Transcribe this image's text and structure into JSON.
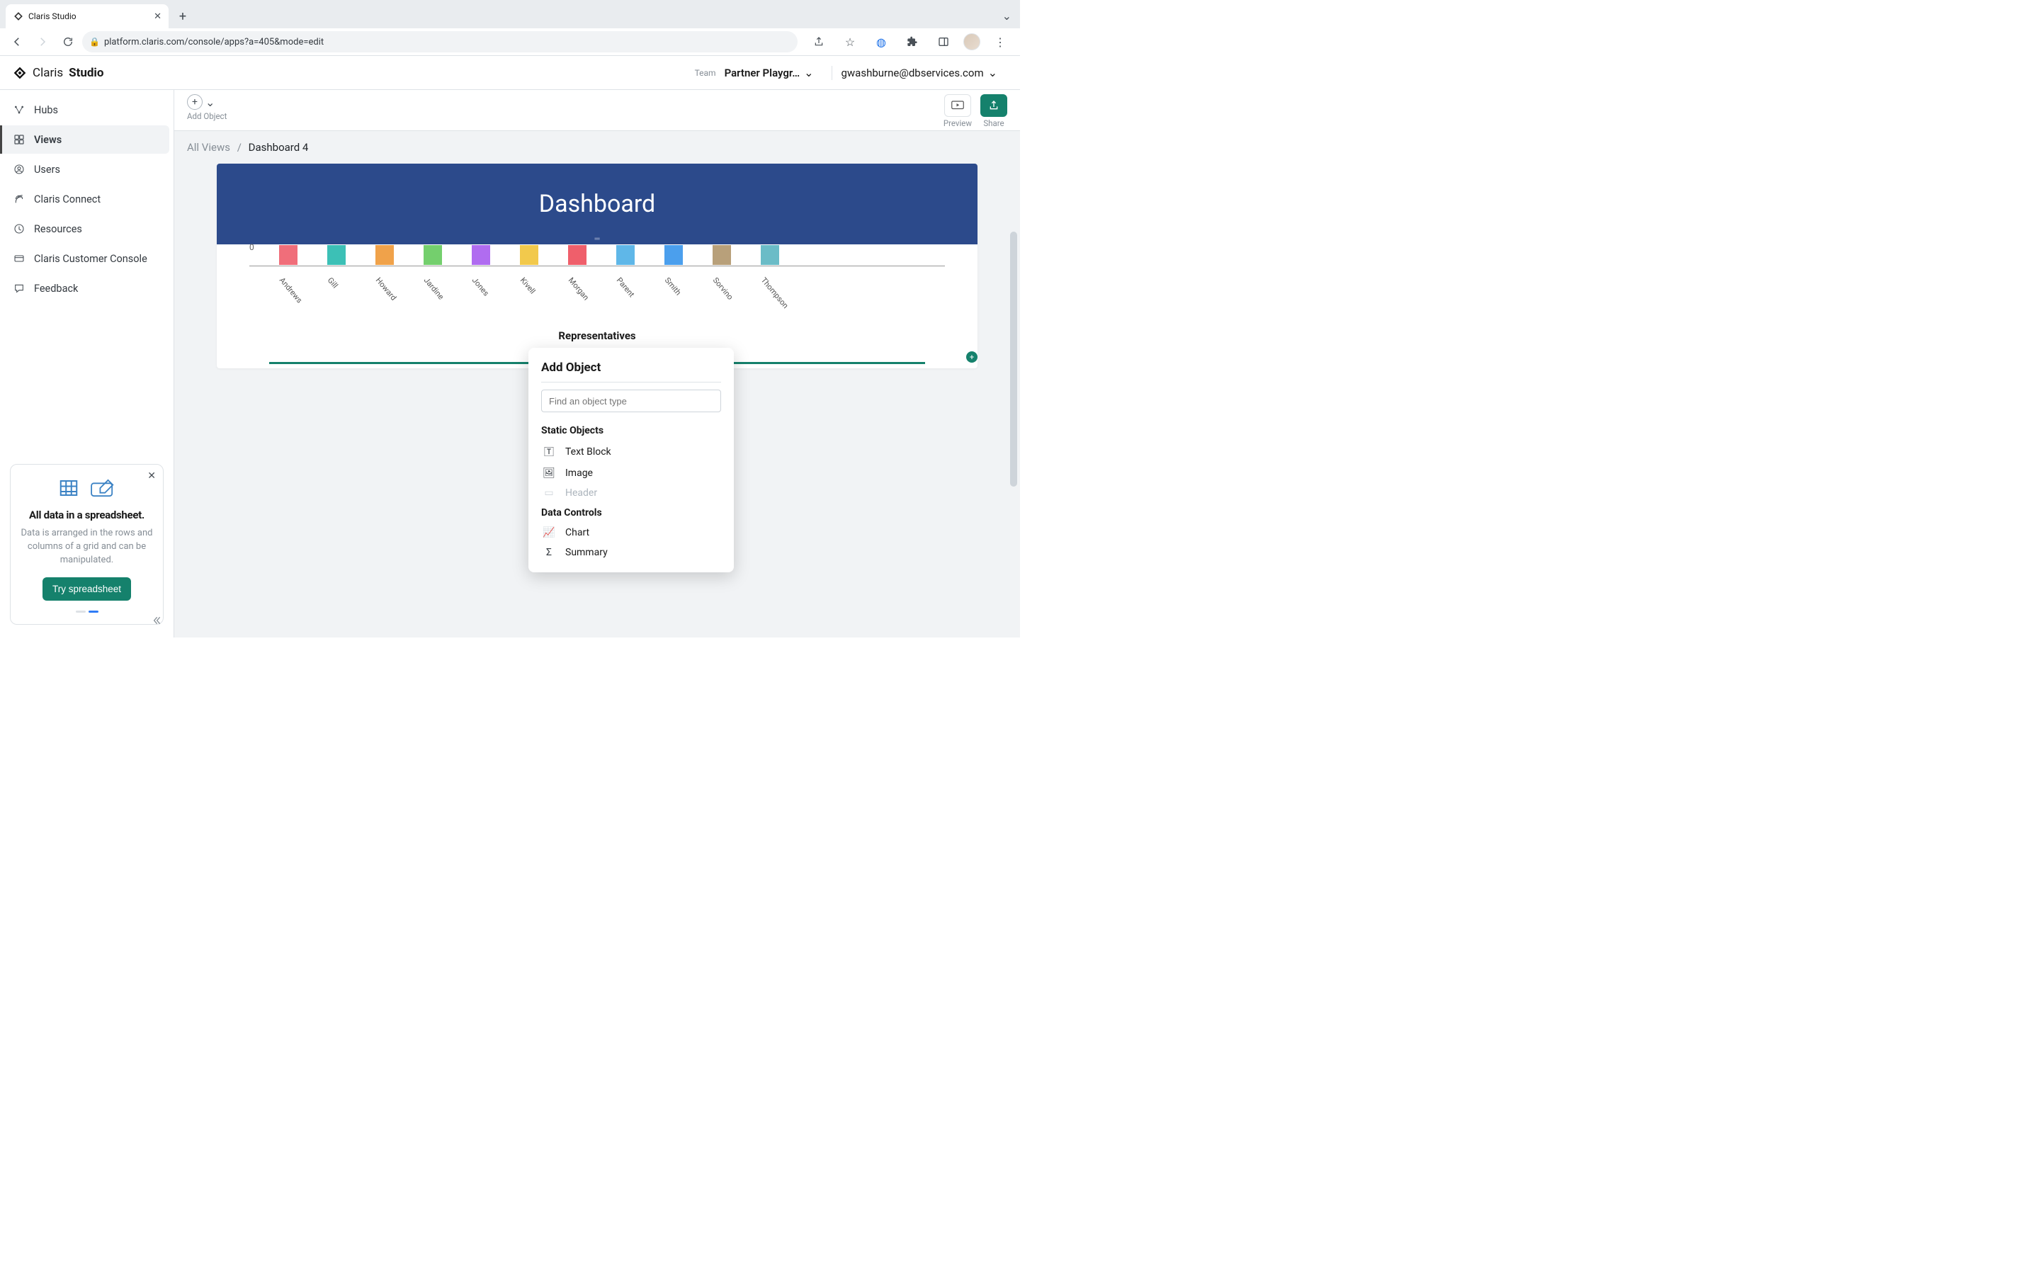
{
  "browser": {
    "tab_title": "Claris Studio",
    "url": "platform.claris.com/console/apps?a=405&mode=edit"
  },
  "header": {
    "brand_word1": "Claris",
    "brand_word2": "Studio",
    "team_label": "Team",
    "team_name": "Partner Playgr…",
    "user": "gwashburne@dbservices.com"
  },
  "sidebar": {
    "items": [
      {
        "label": "Hubs",
        "icon": "hubs"
      },
      {
        "label": "Views",
        "icon": "views",
        "active": true
      },
      {
        "label": "Users",
        "icon": "users"
      },
      {
        "label": "Claris Connect",
        "icon": "connect"
      },
      {
        "label": "Resources",
        "icon": "resources"
      },
      {
        "label": "Claris Customer Console",
        "icon": "console"
      },
      {
        "label": "Feedback",
        "icon": "feedback"
      }
    ],
    "promo": {
      "title": "All data in a spreadsheet.",
      "body": "Data is arranged in the rows and columns of a grid and can be manipulated.",
      "cta": "Try spreadsheet"
    }
  },
  "content_toolbar": {
    "add_object_label": "Add Object",
    "preview_label": "Preview",
    "share_label": "Share"
  },
  "breadcrumbs": {
    "root": "All Views",
    "sep": "/",
    "current": "Dashboard 4"
  },
  "hero": {
    "title": "Dashboard"
  },
  "chart_data": {
    "type": "bar",
    "title": "Representatives",
    "ylabel_tick": "0",
    "categories": [
      "Andrews",
      "Gill",
      "Howard",
      "Jardine",
      "Jones",
      "Kivell",
      "Morgan",
      "Parent",
      "Smith",
      "Sorvino",
      "Thompson"
    ],
    "values": [
      1,
      1,
      1,
      1,
      1,
      1,
      1,
      1,
      1,
      1,
      1
    ],
    "colors": [
      "#f06e7a",
      "#3cc0b6",
      "#f0a24a",
      "#74cf6d",
      "#b06cf0",
      "#f2c94c",
      "#ef5f6b",
      "#5fb7e8",
      "#4b9fed",
      "#b8a07a",
      "#6bbcc7"
    ],
    "ylim": [
      0,
      1
    ]
  },
  "popover": {
    "title": "Add Object",
    "placeholder": "Find an object type",
    "groups": [
      {
        "label": "Static Objects",
        "options": [
          {
            "label": "Text Block",
            "icon": "text",
            "enabled": true
          },
          {
            "label": "Image",
            "icon": "image",
            "enabled": true
          },
          {
            "label": "Header",
            "icon": "header",
            "enabled": false
          }
        ]
      },
      {
        "label": "Data Controls",
        "options": [
          {
            "label": "Chart",
            "icon": "chart",
            "enabled": true
          },
          {
            "label": "Summary",
            "icon": "summary",
            "enabled": true
          }
        ]
      }
    ]
  }
}
